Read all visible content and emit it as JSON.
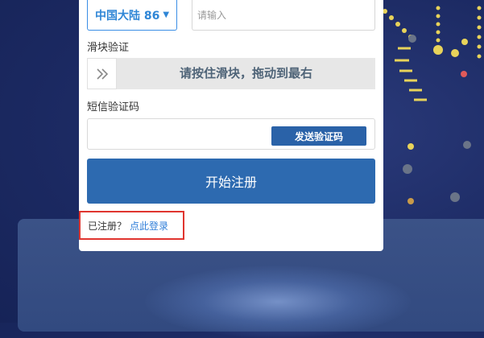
{
  "form": {
    "country_code": "中国大陆 86",
    "phone_placeholder": "请输入",
    "slider_label": "滑块验证",
    "slider_text": "请按住滑块，拖动到最右",
    "sms_label": "短信验证码",
    "sms_value": "",
    "send_code_button": "发送验证码",
    "register_button": "开始注册",
    "already_registered": "已注册？",
    "login_link": "点此登录"
  },
  "colors": {
    "primary": "#2d6ab0",
    "link": "#2f7ed8",
    "highlight_box": "#e0352f",
    "background": "#1c2a63"
  },
  "icons": {
    "slider_handle": "double-chevron-right-icon",
    "country_dropdown": "caret-down-icon"
  }
}
